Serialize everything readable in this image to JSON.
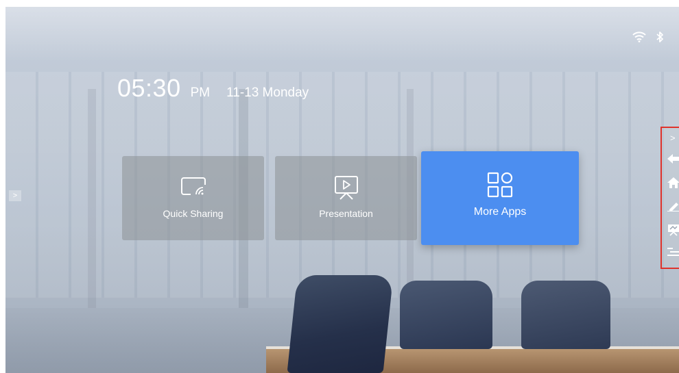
{
  "status_bar": {
    "wifi_icon": "wifi-icon",
    "bluetooth_icon": "bluetooth-icon"
  },
  "clock": {
    "time": "05:30",
    "ampm": "PM",
    "date": "11-13 Monday"
  },
  "tiles": [
    {
      "label": "Quick Sharing",
      "icon": "screen-cast-icon"
    },
    {
      "label": "Presentation",
      "icon": "projector-icon"
    },
    {
      "label": "More Apps",
      "icon": "app-grid-icon"
    }
  ],
  "left_handle": {
    "glyph": ">"
  },
  "sidebar": {
    "expand_glyph": ">",
    "items": [
      "back-icon",
      "home-icon",
      "pen-icon",
      "whiteboard-icon",
      "menu-icon"
    ]
  },
  "colors": {
    "accent": "#4c8ef0",
    "highlight_border": "#e0322b"
  }
}
